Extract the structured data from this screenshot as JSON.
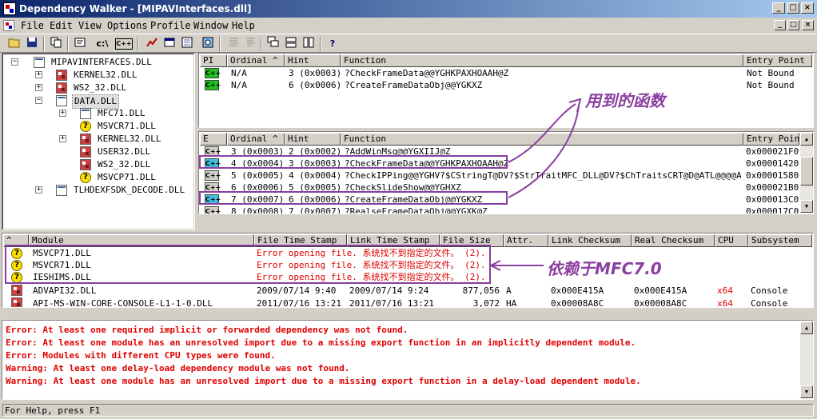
{
  "window": {
    "title": "Dependency Walker - [MIPAVInterfaces.dll]",
    "min_glyph": "_",
    "max_glyph": "□",
    "close_glyph": "×"
  },
  "menu": [
    "File",
    "Edit",
    "View",
    "Options",
    "Profile",
    "Window",
    "Help"
  ],
  "toolbar": {
    "c_drive_label": "c:\\",
    "cpp_label": "C++",
    "help_glyph": "?"
  },
  "tree": [
    {
      "label": "MIPAVINTERFACES.DLL",
      "icon": "plain",
      "expander": "−"
    },
    {
      "label": "KERNEL32.DLL",
      "icon": "red",
      "expander": "+"
    },
    {
      "label": "WS2_32.DLL",
      "icon": "red",
      "expander": "+"
    },
    {
      "label": "DATA.DLL",
      "icon": "plain",
      "expander": "−"
    },
    {
      "label": "MFC71.DLL",
      "icon": "plain",
      "expander": "+"
    },
    {
      "label": "MSVCR71.DLL",
      "icon": "missing",
      "expander": ""
    },
    {
      "label": "KERNEL32.DLL",
      "icon": "red",
      "expander": "+"
    },
    {
      "label": "USER32.DLL",
      "icon": "red",
      "expander": ""
    },
    {
      "label": "WS2_32.DLL",
      "icon": "red",
      "expander": ""
    },
    {
      "label": "MSVCP71.DLL",
      "icon": "missing",
      "expander": ""
    },
    {
      "label": "TLHDEXFSDK_DECODE.DLL",
      "icon": "plain",
      "expander": "+"
    }
  ],
  "parent_imports": {
    "headers": [
      "PI",
      "Ordinal ^",
      "Hint",
      "Function",
      "Entry Point"
    ],
    "rows": [
      {
        "icon": "C++",
        "ordinal": "N/A",
        "hint": "3 (0x0003)",
        "function": "?CheckFrameData@@YGHKPAXHOAAH@Z",
        "entry": "Not Bound"
      },
      {
        "icon": "C++",
        "ordinal": "N/A",
        "hint": "6 (0x0006)",
        "function": "?CreateFrameDataObj@@YGKXZ",
        "entry": "Not Bound"
      }
    ]
  },
  "exports": {
    "headers": [
      "E",
      "Ordinal ^",
      "Hint",
      "Function",
      "Entry Point"
    ],
    "rows": [
      {
        "icon": "C++",
        "ordinal": "3 (0x0003)",
        "hint": "2 (0x0002)",
        "function": "?AddWinMsg@@YGXIIJ@Z",
        "entry": "0x000021F0"
      },
      {
        "icon": "C++",
        "ordinal": "4 (0x0004)",
        "hint": "3 (0x0003)",
        "function": "?CheckFrameData@@YGHKPAXHOAAH@Z",
        "entry": "0x00001420"
      },
      {
        "icon": "C++",
        "ordinal": "5 (0x0005)",
        "hint": "4 (0x0004)",
        "function": "?CheckIPPing@@YGHV?$CStringT@DV?$StrTraitMFC_DLL@DV?$ChTraitsCRT@D@ATL@@@@ATL@@@Z",
        "entry": "0x00001580"
      },
      {
        "icon": "C++",
        "ordinal": "6 (0x0006)",
        "hint": "5 (0x0005)",
        "function": "?CheckSlideShow@@YGHXZ",
        "entry": "0x000021B0"
      },
      {
        "icon": "C++",
        "ordinal": "7 (0x0007)",
        "hint": "6 (0x0006)",
        "function": "?CreateFrameDataObj@@YGKXZ",
        "entry": "0x000013C0"
      },
      {
        "icon": "C++",
        "ordinal": "8 (0x0008)",
        "hint": "7 (0x0007)",
        "function": "?RealseFrameDataObj@@YGXK@Z",
        "entry": "0x000017C0"
      }
    ]
  },
  "modules": {
    "headers": [
      "^",
      "Module",
      "File Time Stamp",
      "Link Time Stamp",
      "File Size",
      "Attr.",
      "Link Checksum",
      "Real Checksum",
      "CPU",
      "Subsystem"
    ],
    "rows": [
      {
        "module": "MSVCP71.DLL",
        "file_ts": "Error opening file. 系统找不到指定的文件。 (2).",
        "link_ts": "",
        "size": "",
        "attr": "",
        "link_ck": "",
        "real_ck": "",
        "cpu": "",
        "subsys": ""
      },
      {
        "module": "MSVCR71.DLL",
        "file_ts": "Error opening file. 系统找不到指定的文件。 (2).",
        "link_ts": "",
        "size": "",
        "attr": "",
        "link_ck": "",
        "real_ck": "",
        "cpu": "",
        "subsys": ""
      },
      {
        "module": "IESHIMS.DLL",
        "file_ts": "Error opening file. 系统找不到指定的文件。 (2).",
        "link_ts": "",
        "size": "",
        "attr": "",
        "link_ck": "",
        "real_ck": "",
        "cpu": "",
        "subsys": ""
      },
      {
        "module": "ADVAPI32.DLL",
        "file_ts": "2009/07/14  9:40",
        "link_ts": "2009/07/14  9:24",
        "size": "877,056",
        "attr": "A",
        "link_ck": "0x000E415A",
        "real_ck": "0x000E415A",
        "cpu": "x64",
        "subsys": "Console"
      },
      {
        "module": "API-MS-WIN-CORE-CONSOLE-L1-1-0.DLL",
        "file_ts": "2011/07/16 13:21",
        "link_ts": "2011/07/16 13:21",
        "size": "3,072",
        "attr": "HA",
        "link_ck": "0x00008A8C",
        "real_ck": "0x00008A8C",
        "cpu": "x64",
        "subsys": "Console"
      }
    ]
  },
  "log": [
    {
      "kind": "Error:",
      "text": "At least one required implicit or forwarded dependency was not found."
    },
    {
      "kind": "Error:",
      "text": "At least one module has an unresolved import due to a missing export function in an implicitly dependent module."
    },
    {
      "kind": "Error:",
      "text": "Modules with different CPU types were found."
    },
    {
      "kind": "Warning:",
      "text": "At least one delay-load dependency module was not found."
    },
    {
      "kind": "Warning:",
      "text": "At least one module has an unresolved import due to a missing export function in a delay-load dependent module."
    }
  ],
  "annotations": {
    "functions_used": "用到的函数",
    "depends_on": "依赖于MFC7.0"
  },
  "status": "For Help, press F1",
  "colors": {
    "annotation": "#8a3fa0",
    "error_text": "#e00000",
    "cpu_mismatch": "#e00000"
  }
}
